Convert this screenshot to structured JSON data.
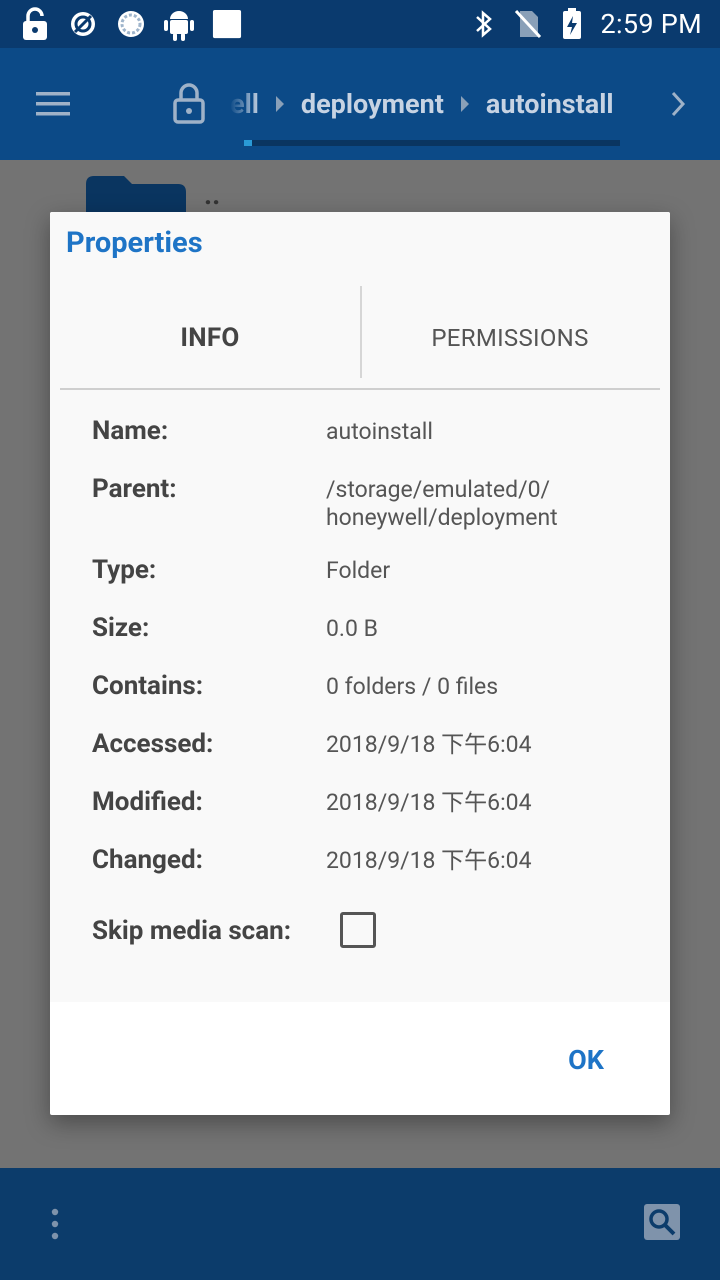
{
  "status_bar": {
    "time": "2:59 PM",
    "left_icons": [
      "unlock-icon",
      "data-saver-icon",
      "sync-icon",
      "android-icon",
      "square-icon"
    ],
    "right_icons": [
      "bluetooth-icon",
      "no-sim-icon",
      "battery-charging-icon"
    ]
  },
  "toolbar": {
    "breadcrumbs": [
      "ell",
      "deployment",
      "autoinstall"
    ]
  },
  "background_list": {
    "parent_item": ".."
  },
  "dialog": {
    "title": "Properties",
    "tabs": [
      {
        "label": "INFO",
        "selected": true
      },
      {
        "label": "PERMISSIONS",
        "selected": false
      }
    ],
    "rows": [
      {
        "label": "Name:",
        "value": "autoinstall"
      },
      {
        "label": "Parent:",
        "value_lines": [
          "/storage/emulated/0/",
          "honeywell/deployment"
        ]
      },
      {
        "label": "Type:",
        "value": "Folder"
      },
      {
        "label": "Size:",
        "value": "0.0 B"
      },
      {
        "label": "Contains:",
        "value": "0 folders / 0 files"
      },
      {
        "label": "Accessed:",
        "value": "2018/9/18 下午6:04"
      },
      {
        "label": "Modified:",
        "value": "2018/9/18 下午6:04"
      },
      {
        "label": "Changed:",
        "value": "2018/9/18 下午6:04"
      }
    ],
    "skip_media_scan": {
      "label": "Skip media scan:",
      "checked": false
    },
    "ok_label": "OK"
  },
  "colors": {
    "accent": "#1e74c6",
    "toolbar": "#0c4a87",
    "status_bar": "#0a3a6e"
  }
}
